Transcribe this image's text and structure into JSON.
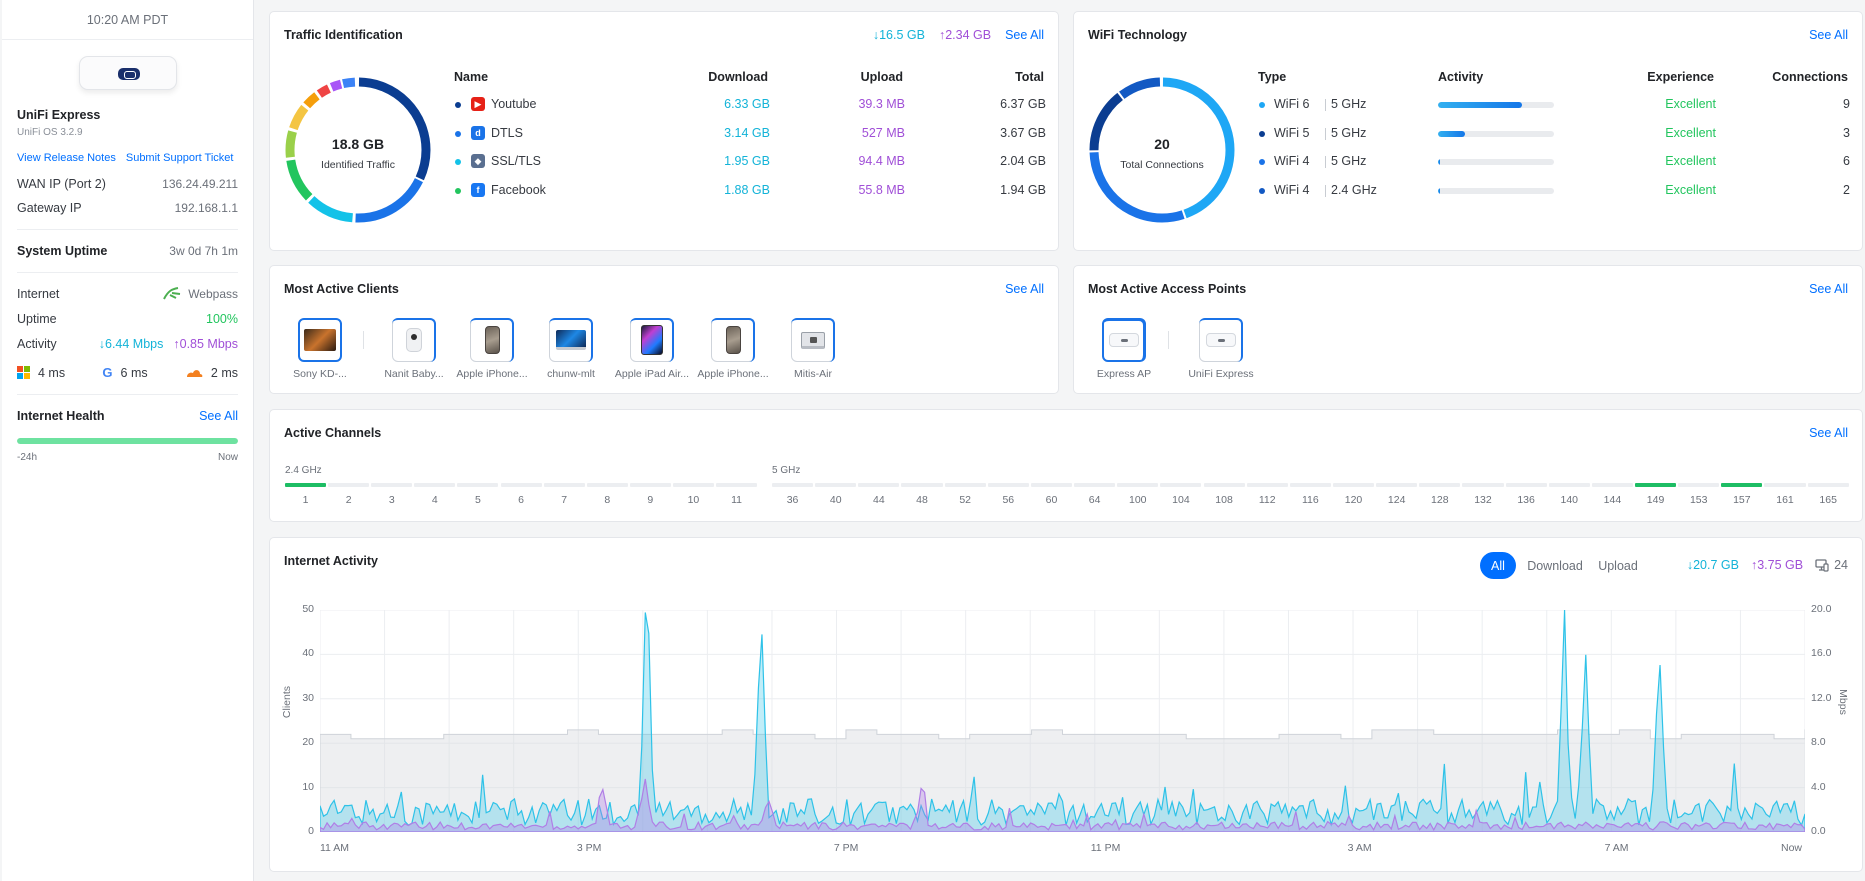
{
  "sidebar": {
    "time": "10:20 AM PDT",
    "device_name": "UniFi Express",
    "os_version": "UniFi OS 3.2.9",
    "links": [
      "View Release Notes",
      "Submit Support Ticket"
    ],
    "wan_label": "WAN IP (Port 2)",
    "wan_value": "136.24.49.211",
    "gateway_label": "Gateway IP",
    "gateway_value": "192.168.1.1",
    "uptime_label": "System Uptime",
    "uptime_value": "3w 0d 7h 1m",
    "internet_label": "Internet",
    "isp": "Webpass",
    "uptime2_label": "Uptime",
    "uptime2_value": "100%",
    "activity_label": "Activity",
    "activity_down": "6.44 Mbps",
    "activity_up": "0.85 Mbps",
    "latency": [
      "4 ms",
      "6 ms",
      "2 ms"
    ],
    "health_title": "Internet Health",
    "health_see_all": "See All",
    "health_start": "-24h",
    "health_end": "Now",
    "health_level": 1.0
  },
  "traffic": {
    "title": "Traffic Identification",
    "total_down": "16.5 GB",
    "total_up": "2.34 GB",
    "see_all": "See All",
    "donut_value": "18.8 GB",
    "donut_label": "Identified Traffic",
    "headers": [
      "Name",
      "Download",
      "Upload",
      "Total"
    ],
    "rows": [
      {
        "name": "Youtube",
        "download": "6.33 GB",
        "upload": "39.3 MB",
        "total": "6.37 GB",
        "color": "#0b3d91"
      },
      {
        "name": "DTLS",
        "download": "3.14 GB",
        "upload": "527 MB",
        "total": "3.67 GB",
        "color": "#1a73e8"
      },
      {
        "name": "SSL/TLS",
        "download": "1.95 GB",
        "upload": "94.4 MB",
        "total": "2.04 GB",
        "color": "#13c2e8"
      },
      {
        "name": "Facebook",
        "download": "1.88 GB",
        "upload": "55.8 MB",
        "total": "1.94 GB",
        "color": "#22c55e"
      }
    ]
  },
  "wifi": {
    "title": "WiFi Technology",
    "see_all": "See All",
    "donut_value": "20",
    "donut_label": "Total Connections",
    "headers": [
      "Type",
      "Activity",
      "Experience",
      "Connections"
    ],
    "rows": [
      {
        "type": "WiFi 6",
        "band": "5 GHz",
        "activity": 0.72,
        "experience": "Excellent",
        "connections": "9",
        "color": "#1ea7f5"
      },
      {
        "type": "WiFi 5",
        "band": "5 GHz",
        "activity": 0.23,
        "experience": "Excellent",
        "connections": "3",
        "color": "#0b3d91"
      },
      {
        "type": "WiFi 4",
        "band": "5 GHz",
        "activity": 0.02,
        "experience": "Excellent",
        "connections": "6",
        "color": "#1a73e8"
      },
      {
        "type": "WiFi 4",
        "band": "2.4 GHz",
        "activity": 0.02,
        "experience": "Excellent",
        "connections": "2",
        "color": "#1259c3"
      }
    ]
  },
  "clients": {
    "title": "Most Active Clients",
    "see_all": "See All",
    "items": [
      "Sony KD-...",
      "Nanit Baby...",
      "Apple iPhone...",
      "chunw-mlt",
      "Apple iPad Air...",
      "Apple iPhone...",
      "Mitis-Air"
    ]
  },
  "aps": {
    "title": "Most Active Access Points",
    "see_all": "See All",
    "items": [
      "Express AP",
      "UniFi Express"
    ]
  },
  "channels": {
    "title": "Active Channels",
    "see_all": "See All",
    "band24_label": "2.4 GHz",
    "band5_label": "5 GHz",
    "band24": [
      "1",
      "2",
      "3",
      "4",
      "5",
      "6",
      "7",
      "8",
      "9",
      "10",
      "11"
    ],
    "band5": [
      "36",
      "40",
      "44",
      "48",
      "52",
      "56",
      "60",
      "64",
      "100",
      "104",
      "108",
      "112",
      "116",
      "120",
      "124",
      "128",
      "132",
      "136",
      "140",
      "144",
      "149",
      "153",
      "157",
      "161",
      "165"
    ],
    "active": [
      "1",
      "149",
      "157"
    ]
  },
  "activity": {
    "title": "Internet Activity",
    "filters": [
      "All",
      "Download",
      "Upload"
    ],
    "total_down": "20.7 GB",
    "total_up": "3.75 GB",
    "clients": "24",
    "left_axis_label": "Clients",
    "right_axis_label": "Mbps",
    "left_ticks": [
      "50",
      "40",
      "30",
      "20",
      "10",
      "0"
    ],
    "right_ticks": [
      "20.0",
      "16.0",
      "12.0",
      "8.0",
      "4.0",
      "0.0"
    ],
    "x_ticks": [
      "11 AM",
      "3 PM",
      "7 PM",
      "11 PM",
      "3 AM",
      "7 AM",
      "Now"
    ]
  },
  "chart_data": {
    "type": "area",
    "x": [
      "11 AM",
      "3 PM",
      "7 PM",
      "11 PM",
      "3 AM",
      "7 AM",
      "Now"
    ],
    "ylabel": "Clients",
    "y2label": "Mbps",
    "ylim": [
      0,
      50
    ],
    "y2lim": [
      0,
      20
    ],
    "series": [
      {
        "name": "Download",
        "color": "#2ec2e8",
        "peaks_mbps": [
          [
            0.22,
            19.5
          ],
          [
            0.297,
            16.0
          ],
          [
            0.838,
            14.2
          ],
          [
            0.852,
            13.5
          ],
          [
            0.902,
            14.3
          ]
        ],
        "baseline_mbps": 2.0
      },
      {
        "name": "Upload",
        "color": "#b07ee6",
        "peaks_mbps": [
          [
            0.19,
            3.5
          ],
          [
            0.219,
            4.0
          ],
          [
            0.302,
            2.5
          ],
          [
            0.405,
            3.4
          ]
        ],
        "baseline_mbps": 0.6
      },
      {
        "name": "Clients",
        "color": "#d9dce1",
        "level_clients": 23
      }
    ]
  }
}
